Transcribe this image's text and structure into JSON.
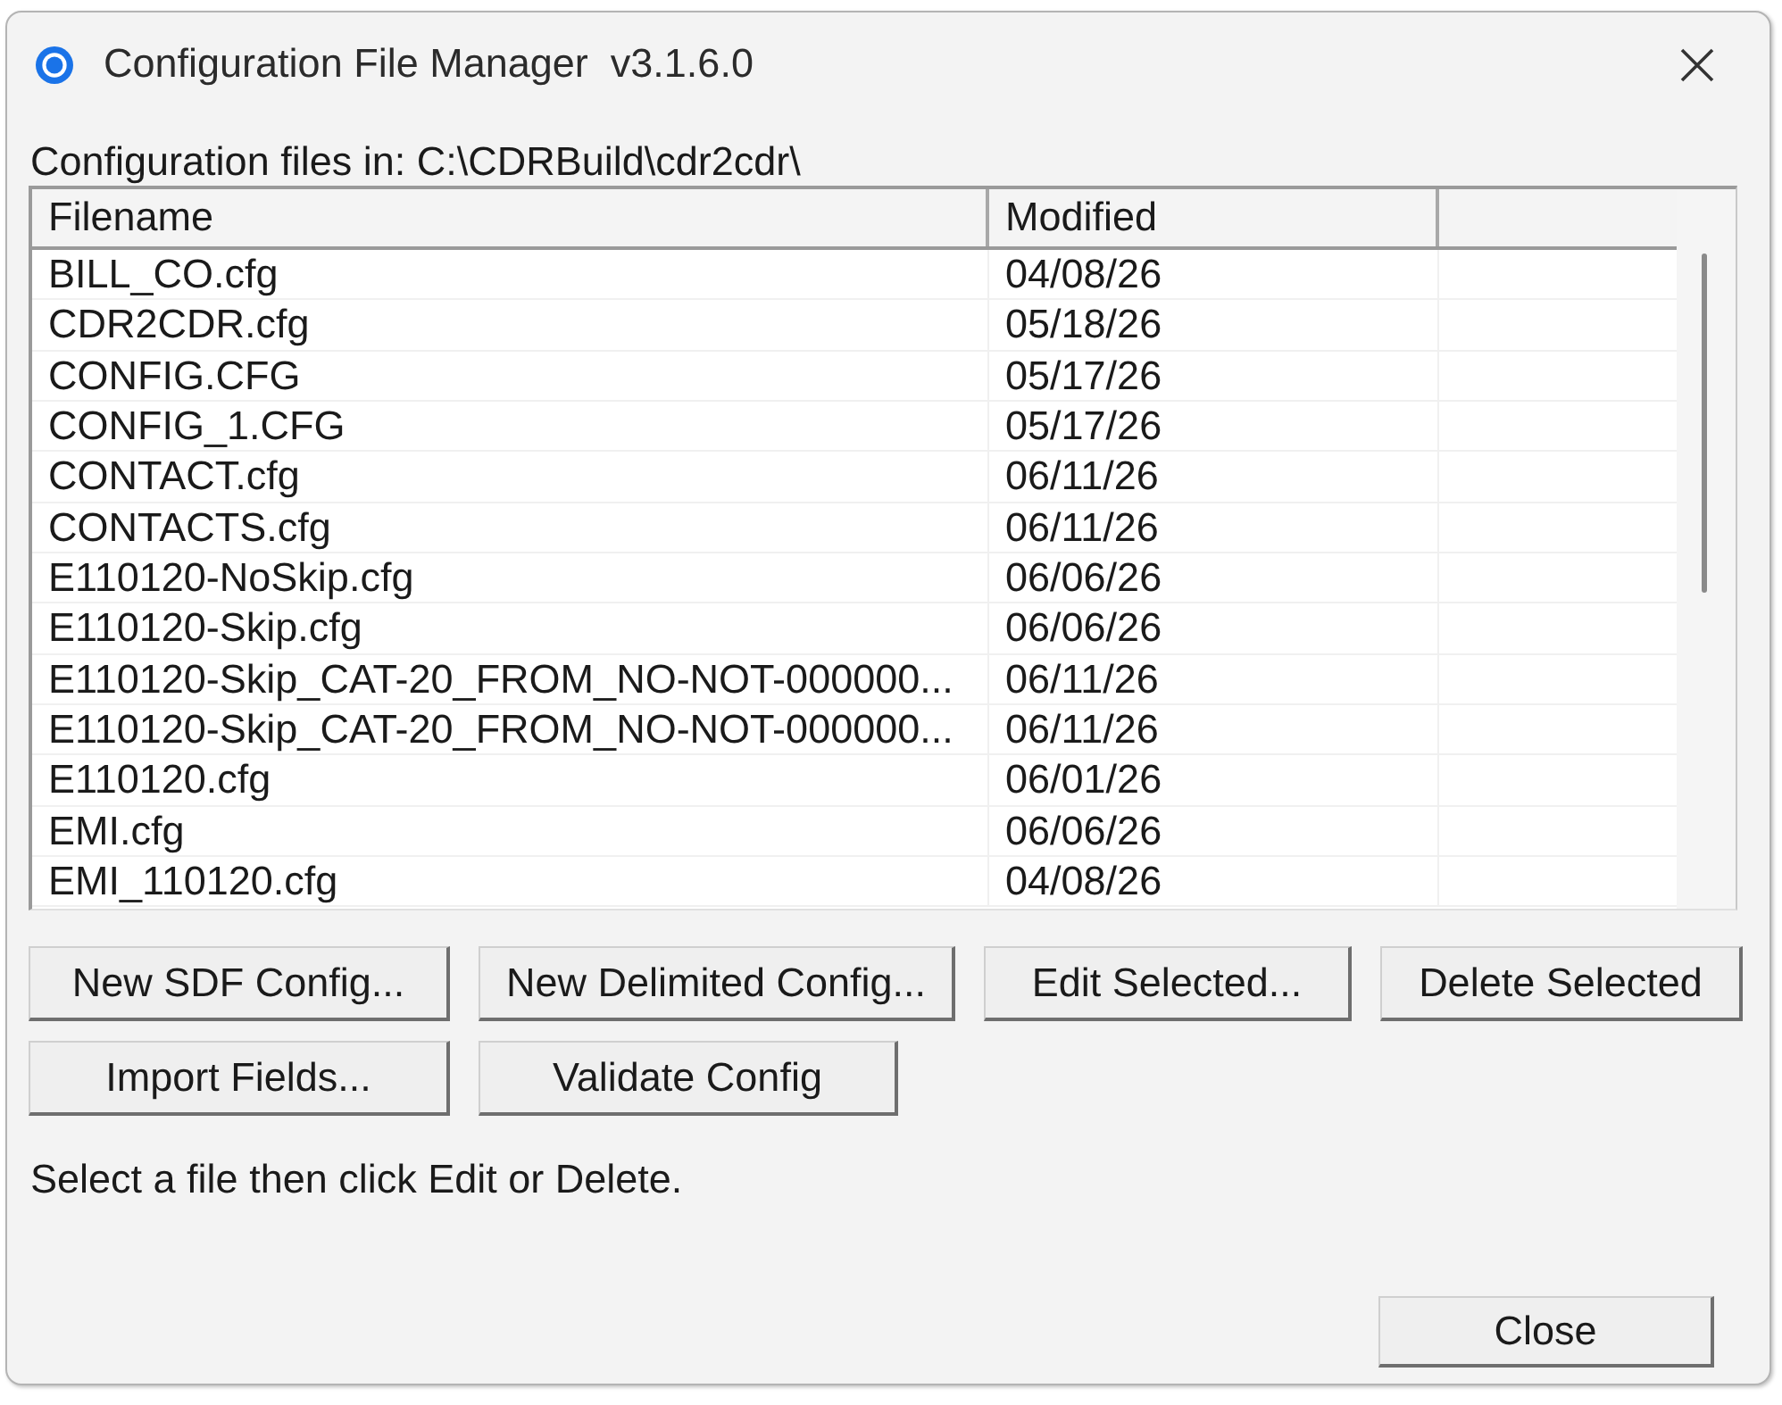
{
  "window": {
    "title": "Configuration File Manager  v3.1.6.0"
  },
  "folder_label": "Configuration files in: C:\\CDRBuild\\cdr2cdr\\",
  "file_list": {
    "columns": [
      "Filename",
      "Modified"
    ],
    "rows": [
      {
        "filename": "BILL_CO.cfg",
        "modified": "04/08/26",
        "selected": false
      },
      {
        "filename": "CDR2CDR.cfg",
        "modified": "05/18/26",
        "selected": false
      },
      {
        "filename": "CONFIG.CFG",
        "modified": "05/17/26",
        "selected": false
      },
      {
        "filename": "CONFIG_1.CFG",
        "modified": "05/17/26",
        "selected": false
      },
      {
        "filename": "CONTACT.cfg",
        "modified": "06/11/26",
        "selected": false
      },
      {
        "filename": "CONTACTS.cfg",
        "modified": "06/11/26",
        "selected": false
      },
      {
        "filename": "E110120-NoSkip.cfg",
        "modified": "06/06/26",
        "selected": false
      },
      {
        "filename": "E110120-Skip.cfg",
        "modified": "06/06/26",
        "selected": false
      },
      {
        "filename": "E110120-Skip_CAT-20_FROM_NO-NOT-000000...",
        "modified": "06/11/26",
        "selected": false
      },
      {
        "filename": "E110120-Skip_CAT-20_FROM_NO-NOT-000000...",
        "modified": "06/11/26",
        "selected": false
      },
      {
        "filename": "E110120.cfg",
        "modified": "06/01/26",
        "selected": false
      },
      {
        "filename": "EMI.cfg",
        "modified": "06/06/26",
        "selected": false
      },
      {
        "filename": "EMI_110120.cfg",
        "modified": "04/08/26",
        "selected": false
      }
    ]
  },
  "button_rows": [
    [
      "New SDF Config...",
      "New Delimited Config...",
      "Edit Selected...",
      "Delete Selected"
    ],
    [
      "Import Fields...",
      "Validate Config"
    ]
  ],
  "status_text": "Select a file then click Edit or Delete.",
  "close_button": "Close"
}
